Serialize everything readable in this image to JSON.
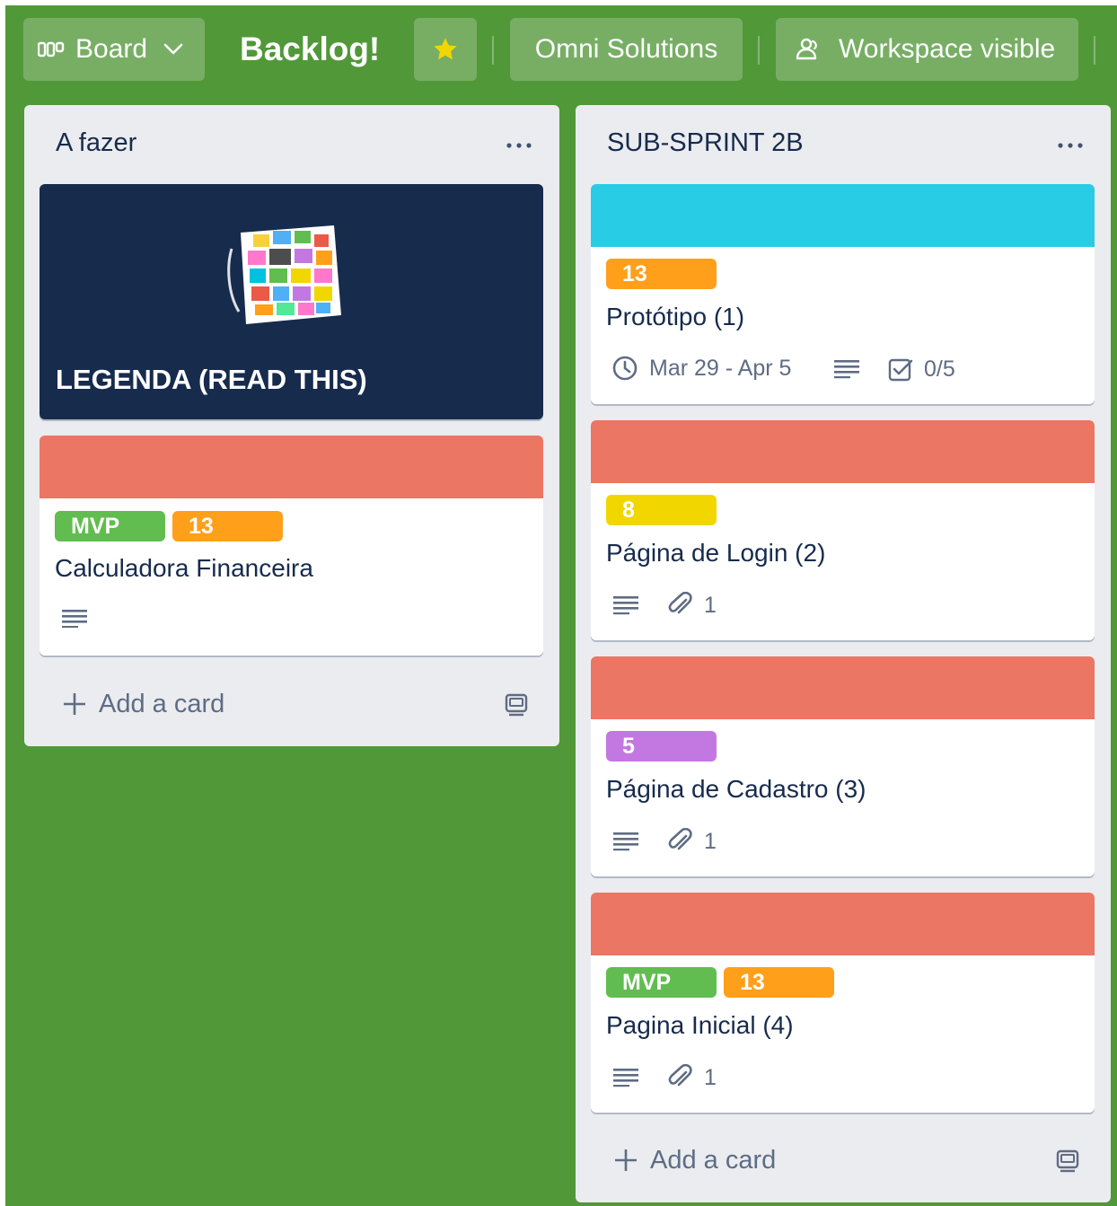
{
  "header": {
    "view_label": "Board",
    "board_title": "Backlog!",
    "workspace_name": "Omni Solutions",
    "visibility_label": "Workspace visible"
  },
  "lists": [
    {
      "title": "A fazer",
      "add_card_label": "Add a card",
      "cards": [
        {
          "title": "LEGENDA (READ THIS)",
          "cover_color": "#172b4d"
        },
        {
          "cover_color": "#eb7663",
          "labels": [
            {
              "text": "MVP",
              "color": "#61bd4f"
            },
            {
              "text": "13",
              "color": "#ff9f1a"
            }
          ],
          "title": "Calculadora Financeira",
          "has_description": true
        }
      ]
    },
    {
      "title": "SUB-SPRINT 2B",
      "add_card_label": "Add a card",
      "cards": [
        {
          "cover_color": "#29cce5",
          "labels": [
            {
              "text": "13",
              "color": "#ff9f1a"
            }
          ],
          "title": "Protótipo (1)",
          "due": "Mar 29 - Apr 5",
          "has_description": true,
          "checklist": "0/5"
        },
        {
          "cover_color": "#eb7663",
          "labels": [
            {
              "text": "8",
              "color": "#f2d600"
            }
          ],
          "title": "Página de Login (2)",
          "has_description": true,
          "attachments": "1"
        },
        {
          "cover_color": "#eb7663",
          "labels": [
            {
              "text": "5",
              "color": "#c377e0"
            }
          ],
          "title": "Página de Cadastro (3)",
          "has_description": true,
          "attachments": "1"
        },
        {
          "cover_color": "#eb7663",
          "labels": [
            {
              "text": "MVP",
              "color": "#61bd4f"
            },
            {
              "text": "13",
              "color": "#ff9f1a"
            }
          ],
          "title": "Pagina Inicial (4)",
          "has_description": true,
          "attachments": "1"
        }
      ]
    }
  ],
  "icons": [
    "board-icon",
    "chevron-down-icon",
    "star-icon",
    "workspace-icon",
    "more-icon",
    "plus-icon",
    "template-icon",
    "clock-icon",
    "description-icon",
    "checklist-icon",
    "paperclip-icon"
  ],
  "colors": {
    "board_background": "#519839",
    "list_background": "#ebecf0",
    "star": "#f2d600"
  }
}
